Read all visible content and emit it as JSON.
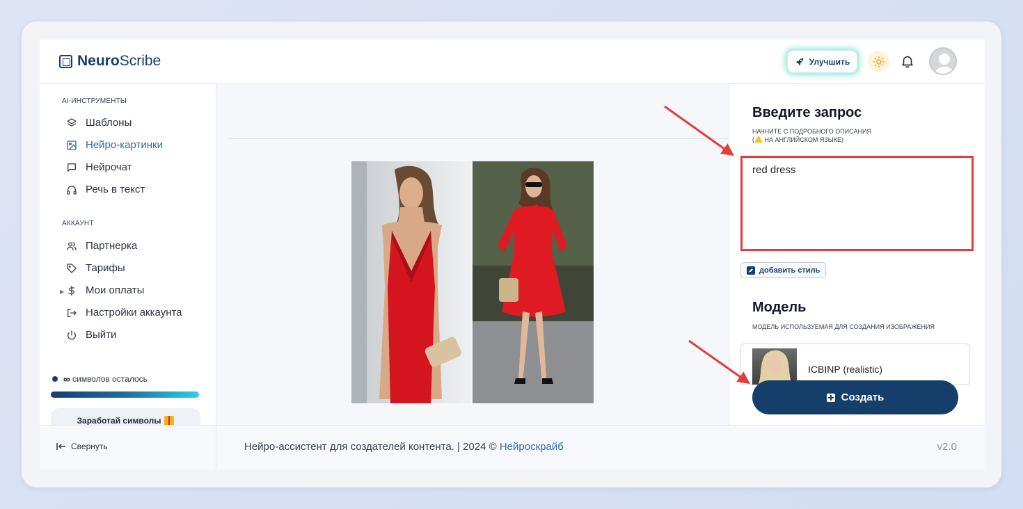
{
  "brand": {
    "bold": "Neuro",
    "regular": "Scribe"
  },
  "header": {
    "upgrade_label": "Улучшить"
  },
  "sidebar": {
    "section_tools": "AI-ИНСТРУМЕНТЫ",
    "tools": [
      {
        "label": "Шаблоны",
        "icon": "layers-icon"
      },
      {
        "label": "Нейро-картинки",
        "icon": "image-icon",
        "active": true
      },
      {
        "label": "Нейрочат",
        "icon": "chat-icon"
      },
      {
        "label": "Речь в текст",
        "icon": "headphones-icon"
      }
    ],
    "section_account": "АККАУНТ",
    "account": [
      {
        "label": "Партнерка",
        "icon": "users-icon"
      },
      {
        "label": "Тарифы",
        "icon": "tag-icon"
      },
      {
        "label": "Мои оплаты",
        "icon": "dollar-icon"
      },
      {
        "label": "Настройки аккаунта",
        "icon": "logout-arrow-icon"
      },
      {
        "label": "Выйти",
        "icon": "power-icon"
      }
    ],
    "credits_symbol": "∞",
    "credits_text": "символов осталось",
    "earn_label": "Заработай символы"
  },
  "panel": {
    "prompt_title": "Введите запрос",
    "prompt_sub_1": "НАЧНИТЕ С ПОДРОБНОГО ОПИСАНИЯ",
    "prompt_sub_2": "НА АНГЛИЙСКОМ ЯЗЫКЕ)",
    "prompt_value": "red dress",
    "add_style_label": "добавить стиль",
    "model_title": "Модель",
    "model_sub": "МОДЕЛЬ ИСПОЛЬЗУЕМАЯ ДЛЯ СОЗДАНИЯ ИЗОБРАЖЕНИЯ",
    "model_name": "ICBINP (realistic)",
    "create_label": "Создать"
  },
  "footer": {
    "collapse_label": "Свернуть",
    "text": "Нейро-ассистент для создателей контента.  | 2024 © ",
    "link": "Нейроскрайб",
    "version": "v2.0"
  },
  "colors": {
    "primary": "#153e6b",
    "accent": "#2a6fa8",
    "highlight": "#e53b3b"
  }
}
